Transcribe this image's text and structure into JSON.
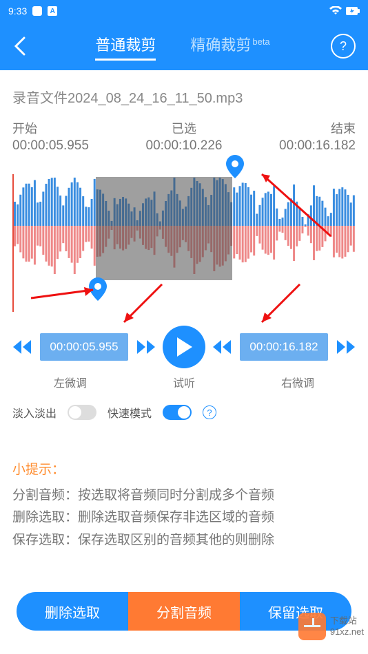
{
  "status": {
    "time": "9:33",
    "notif_a": "A"
  },
  "header": {
    "tab_normal": "普通裁剪",
    "tab_precise": "精确裁剪",
    "beta": "beta"
  },
  "file": {
    "name": "录音文件2024_08_24_16_11_50.mp3"
  },
  "times": {
    "start_label": "开始",
    "start_value": "00:00:05.955",
    "selected_label": "已选",
    "selected_value": "00:00:10.226",
    "end_label": "结束",
    "end_value": "00:00:16.182"
  },
  "controls": {
    "left_time": "00:00:05.955",
    "right_time": "00:00:16.182",
    "left_label": "左微调",
    "play_label": "试听",
    "right_label": "右微调"
  },
  "toggles": {
    "fade_label": "淡入淡出",
    "fast_label": "快速模式"
  },
  "tips": {
    "title": "小提示：",
    "line1": "分割音频：按选取将音频同时分割成多个音频",
    "line2": "删除选取：删除选取音频保存非选区域的音频",
    "line3": "保存选取：保存选取区别的音频其他的则删除"
  },
  "buttons": {
    "delete": "删除选取",
    "split": "分割音频",
    "keep": "保留选取"
  },
  "watermark": {
    "line1": "下载站",
    "line2": "91xz.net"
  }
}
